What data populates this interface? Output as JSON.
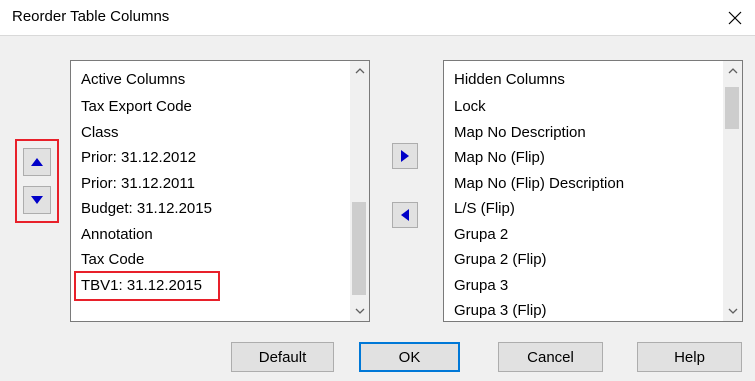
{
  "window": {
    "title": "Reorder Table Columns",
    "close_icon": "close-icon"
  },
  "move_controls": {
    "up_icon": "triangle-up-icon",
    "down_icon": "triangle-down-icon",
    "arrow_color": "#0000c8",
    "highlight_color": "#e8202a"
  },
  "active_list": {
    "header": "Active Columns",
    "items": [
      "Tax Export Code",
      "Class",
      "Prior: 31.12.2012",
      "Prior: 31.12.2011",
      "Budget: 31.12.2015",
      "Annotation",
      "Tax Code",
      "TBV1: 31.12.2015"
    ],
    "highlighted_item": "TBV1: 31.12.2015",
    "scroll_position": 0.85
  },
  "hidden_list": {
    "header": "Hidden Columns",
    "items": [
      "Lock",
      "Map No Description",
      "Map No (Flip)",
      "Map No (Flip) Description",
      "L/S (Flip)",
      "Grupa 2",
      "Grupa 2 (Flip)",
      "Grupa 3",
      "Grupa 3 (Flip)"
    ],
    "scroll_position": 0.0
  },
  "transfer": {
    "move_right_icon": "triangle-right-icon",
    "move_left_icon": "triangle-left-icon"
  },
  "buttons": {
    "default_label": "Default",
    "ok_label": "OK",
    "cancel_label": "Cancel",
    "help_label": "Help",
    "focus_color": "#0078d7"
  }
}
